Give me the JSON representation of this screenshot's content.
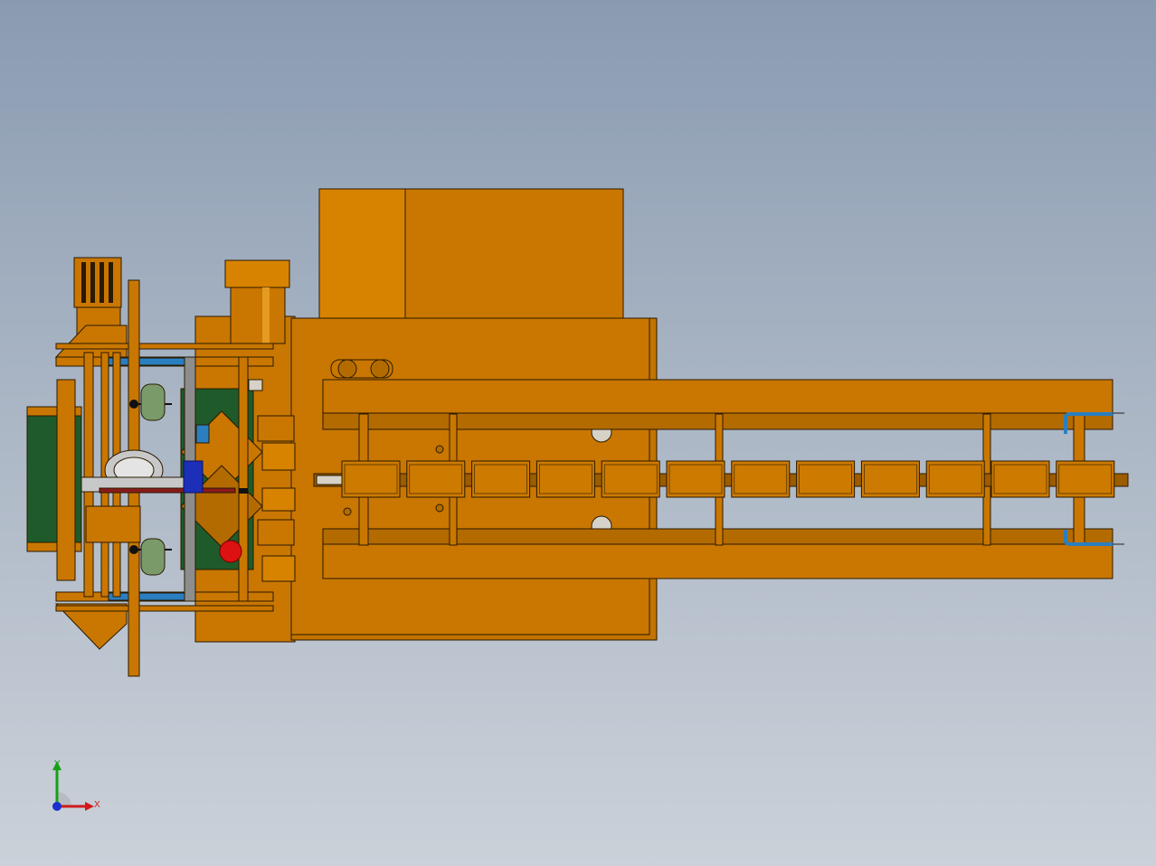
{
  "viewport": {
    "background_top": "#8a9bb1",
    "background_bottom": "#cbd1d9"
  },
  "model": {
    "body_color": "#cc7a00",
    "body_dark": "#9c5c00",
    "outline_color": "#2a1a00",
    "belt_color": "#1f5a2a",
    "accent_blue": "#1c2fb8",
    "accent_red": "#dd1111",
    "conveyor_block_count": 12
  },
  "triad": {
    "x_label": "X",
    "y_label": "Y",
    "x_color": "#d11a1a",
    "y_color": "#16a016",
    "z_color": "#1b2fd0"
  }
}
